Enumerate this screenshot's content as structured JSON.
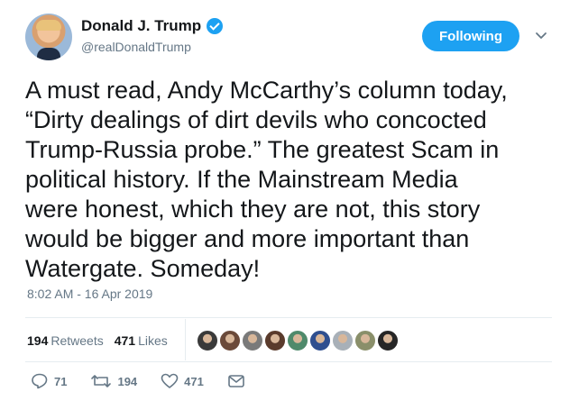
{
  "user": {
    "name": "Donald J. Trump",
    "handle": "@realDonaldTrump"
  },
  "follow_button": {
    "label": "Following"
  },
  "tweet": {
    "text": "A must read, Andy McCarthy’s column today,\n“Dirty dealings of dirt devils who concocted\nTrump-Russia probe.” The greatest Scam in\npolitical history. If the Mainstream Media\nwere honest, which they are not, this story\nwould be bigger and more important than\nWatergate. Someday!",
    "timestamp": "8:02 AM - 16 Apr 2019"
  },
  "stats": {
    "retweets_count": "194",
    "retweets_label": "Retweets",
    "likes_count": "471",
    "likes_label": "Likes"
  },
  "likers": [
    {
      "color": "#3a3a3a"
    },
    {
      "color": "#6b4a3a"
    },
    {
      "color": "#7a7a7a"
    },
    {
      "color": "#5a3b2c"
    },
    {
      "color": "#4f8a6b"
    },
    {
      "color": "#2f4f8f"
    },
    {
      "color": "#a8b0b8"
    },
    {
      "color": "#8a8f6a"
    },
    {
      "color": "#262626"
    }
  ],
  "actions": {
    "reply_count": "71",
    "retweet_count": "194",
    "like_count": "471"
  },
  "colors": {
    "accent": "#1da1f2",
    "text": "#14171a",
    "secondary_text": "#657786",
    "divider": "#e6ecf0"
  },
  "icons": [
    "verified-badge-icon",
    "chevron-down-icon",
    "reply-icon",
    "retweet-icon",
    "like-icon",
    "direct-message-icon"
  ]
}
